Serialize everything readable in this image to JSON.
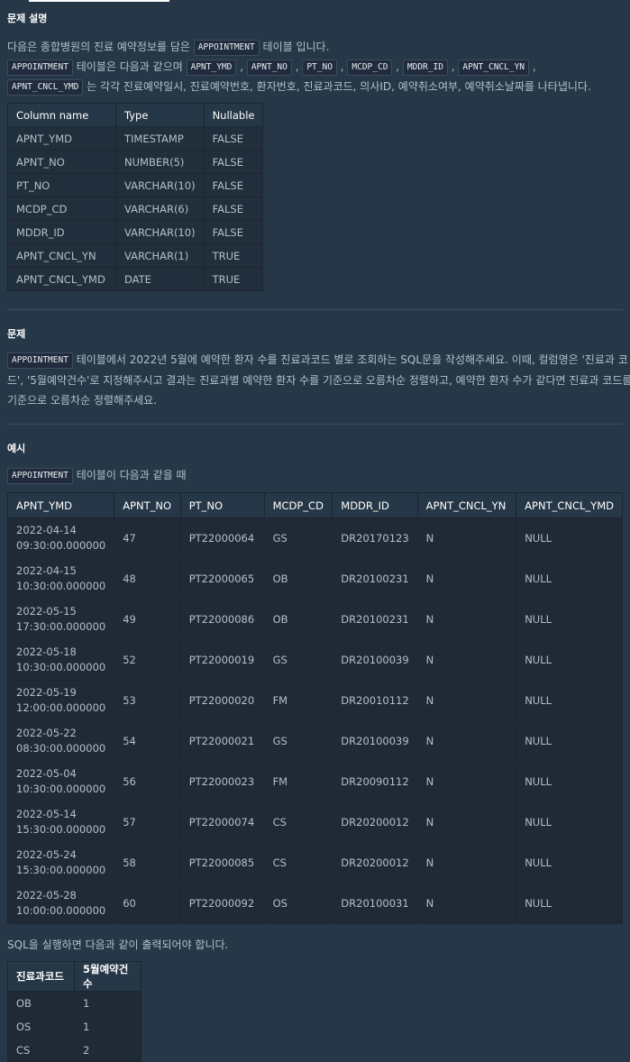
{
  "section1": {
    "heading": "문제 설명",
    "line1_pre": "다음은 종합병원의 진료 예약정보를 담은",
    "line1_code": "APPOINTMENT",
    "line1_post": "테이블 입니다.",
    "line2_code": "APPOINTMENT",
    "line2_text": "테이블은 다음과 같으며",
    "columns_codes": [
      "APNT_YMD",
      "APNT_NO",
      "PT_NO",
      "MCDP_CD",
      "MDDR_ID",
      "APNT_CNCL_YN",
      "APNT_CNCL_YMD"
    ],
    "line3_text": "는 각각 진료예약일시, 진료예약번호, 환자번호, 진료과코드, 의사ID, 예약취소여부, 예약취소날짜를 나타냅니다.",
    "schema_headers": [
      "Column name",
      "Type",
      "Nullable"
    ],
    "schema_rows": [
      [
        "APNT_YMD",
        "TIMESTAMP",
        "FALSE"
      ],
      [
        "APNT_NO",
        "NUMBER(5)",
        "FALSE"
      ],
      [
        "PT_NO",
        "VARCHAR(10)",
        "FALSE"
      ],
      [
        "MCDP_CD",
        "VARCHAR(6)",
        "FALSE"
      ],
      [
        "MDDR_ID",
        "VARCHAR(10)",
        "FALSE"
      ],
      [
        "APNT_CNCL_YN",
        "VARCHAR(1)",
        "TRUE"
      ],
      [
        "APNT_CNCL_YMD",
        "DATE",
        "TRUE"
      ]
    ]
  },
  "section2": {
    "heading": "문제",
    "code": "APPOINTMENT",
    "line1": "테이블에서 2022년 5월에 예약한 환자 수를 진료과코드 별로 조회하는 SQL문을 작성해주세요. 이때, 컬럼명은 '진료과 코",
    "line2": "드', '5월예약건수'로 지정해주시고 결과는 진료과별 예약한 환자 수를 기준으로 오름차순 정렬하고, 예약한 환자 수가 같다면 진료과 코드를",
    "line3": "기준으로 오름차순 정렬해주세요."
  },
  "section3": {
    "heading": "예시",
    "code": "APPOINTMENT",
    "intro_text": "테이블이 다음과 같을 때",
    "example_headers": [
      "APNT_YMD",
      "APNT_NO",
      "PT_NO",
      "MCDP_CD",
      "MDDR_ID",
      "APNT_CNCL_YN",
      "APNT_CNCL_YMD"
    ],
    "example_rows": [
      [
        "2022-04-14",
        "09:30:00.000000",
        "47",
        "PT22000064",
        "GS",
        "DR20170123",
        "N",
        "NULL"
      ],
      [
        "2022-04-15",
        "10:30:00.000000",
        "48",
        "PT22000065",
        "OB",
        "DR20100231",
        "N",
        "NULL"
      ],
      [
        "2022-05-15",
        "17:30:00.000000",
        "49",
        "PT22000086",
        "OB",
        "DR20100231",
        "N",
        "NULL"
      ],
      [
        "2022-05-18",
        "10:30:00.000000",
        "52",
        "PT22000019",
        "GS",
        "DR20100039",
        "N",
        "NULL"
      ],
      [
        "2022-05-19",
        "12:00:00.000000",
        "53",
        "PT22000020",
        "FM",
        "DR20010112",
        "N",
        "NULL"
      ],
      [
        "2022-05-22",
        "08:30:00.000000",
        "54",
        "PT22000021",
        "GS",
        "DR20100039",
        "N",
        "NULL"
      ],
      [
        "2022-05-04",
        "10:30:00.000000",
        "56",
        "PT22000023",
        "FM",
        "DR20090112",
        "N",
        "NULL"
      ],
      [
        "2022-05-14",
        "15:30:00.000000",
        "57",
        "PT22000074",
        "CS",
        "DR20200012",
        "N",
        "NULL"
      ],
      [
        "2022-05-24",
        "15:30:00.000000",
        "58",
        "PT22000085",
        "CS",
        "DR20200012",
        "N",
        "NULL"
      ],
      [
        "2022-05-28",
        "10:00:00.000000",
        "60",
        "PT22000092",
        "OS",
        "DR20100031",
        "N",
        "NULL"
      ]
    ],
    "result_intro": "SQL을 실행하면 다음과 같이 출력되어야 합니다.",
    "result_headers": [
      "진료과코드",
      "5월예약건수"
    ],
    "result_rows": [
      [
        "OB",
        "1"
      ],
      [
        "OS",
        "1"
      ],
      [
        "CS",
        "2"
      ]
    ]
  }
}
